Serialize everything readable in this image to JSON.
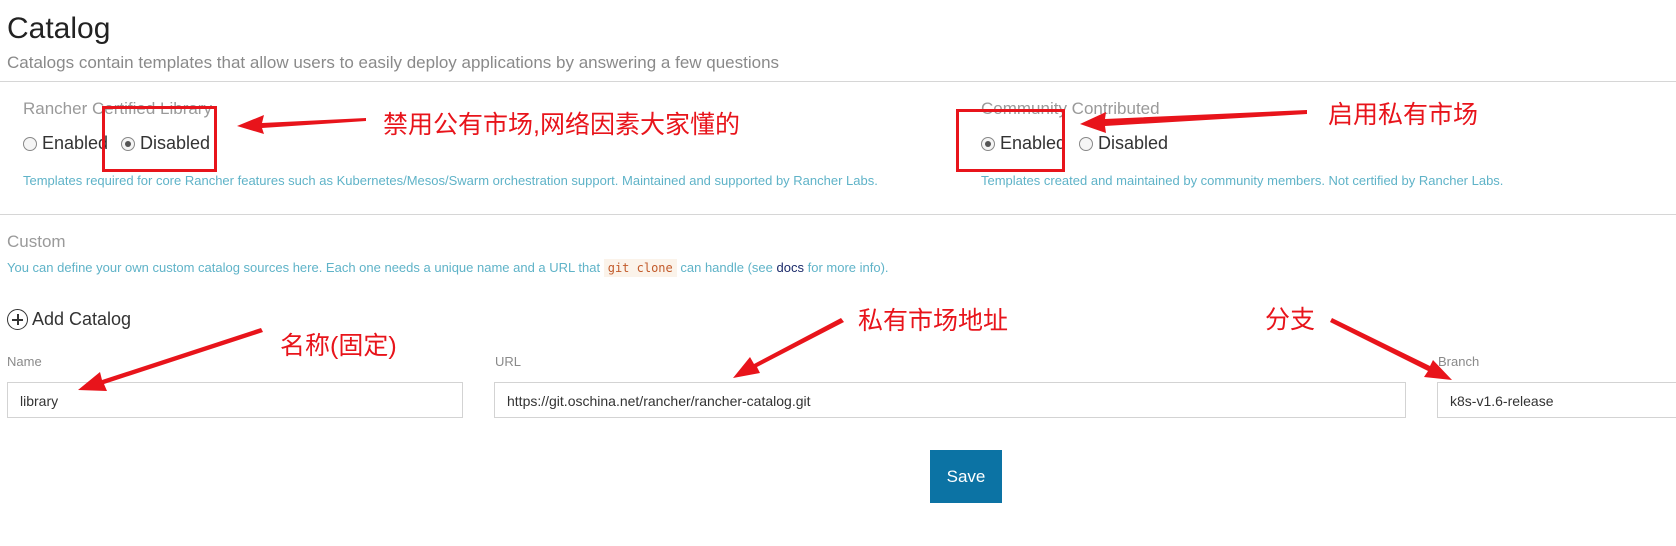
{
  "header": {
    "title": "Catalog",
    "subtitle": "Catalogs contain templates that allow users to easily deploy applications by answering a few questions"
  },
  "rancher_library": {
    "label": "Rancher Certified Library",
    "enabled_label": "Enabled",
    "disabled_label": "Disabled",
    "selected": "Disabled",
    "description": "Templates required for core Rancher features such as Kubernetes/Mesos/Swarm orchestration support. Maintained and supported by Rancher Labs."
  },
  "community": {
    "label": "Community Contributed",
    "enabled_label": "Enabled",
    "disabled_label": "Disabled",
    "selected": "Enabled",
    "description": "Templates created and maintained by community members. Not certified by Rancher Labs."
  },
  "custom": {
    "label": "Custom",
    "help_prefix": "You can define your own custom catalog sources here. Each one needs a unique name and a URL that",
    "help_code": "git clone",
    "help_middle": "can handle (see",
    "help_link": "docs",
    "help_suffix": "for more info).",
    "add_button": "Add Catalog",
    "name_label": "Name",
    "url_label": "URL",
    "branch_label": "Branch",
    "name_value": "library",
    "url_value": "https://git.oschina.net/rancher/rancher-catalog.git",
    "branch_value": "k8s-v1.6-release"
  },
  "save_button": "Save",
  "annotations": {
    "disable_public": "禁用公有市场,网络因素大家懂的",
    "enable_private": "启用私有市场",
    "name_fixed": "名称(固定)",
    "private_url": "私有市场地址",
    "branch": "分支",
    "color": "#e8141b"
  }
}
